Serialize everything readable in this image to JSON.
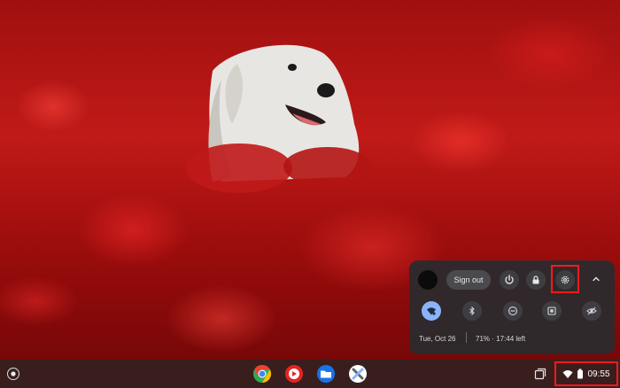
{
  "quick_settings": {
    "sign_out_label": "Sign out",
    "date": "Tue, Oct 26",
    "battery": "71% · 17:44 left",
    "buttons": [
      "power-icon",
      "lock-icon",
      "gear-icon",
      "chevron-up-icon"
    ],
    "tiles": [
      "wifi-icon",
      "bluetooth-icon",
      "do-not-disturb-icon",
      "screen-capture-icon",
      "privacy-screen-icon"
    ]
  },
  "shelf": {
    "apps": [
      "chrome-icon",
      "youtube-icon",
      "files-icon",
      "explore-icon"
    ],
    "time": "09:55",
    "status_icons": [
      "wifi-icon",
      "battery-icon"
    ]
  },
  "colors": {
    "highlight": "#ff1a1a",
    "tile_active": "#8ab4f8",
    "panel": "#2b2b2e"
  }
}
